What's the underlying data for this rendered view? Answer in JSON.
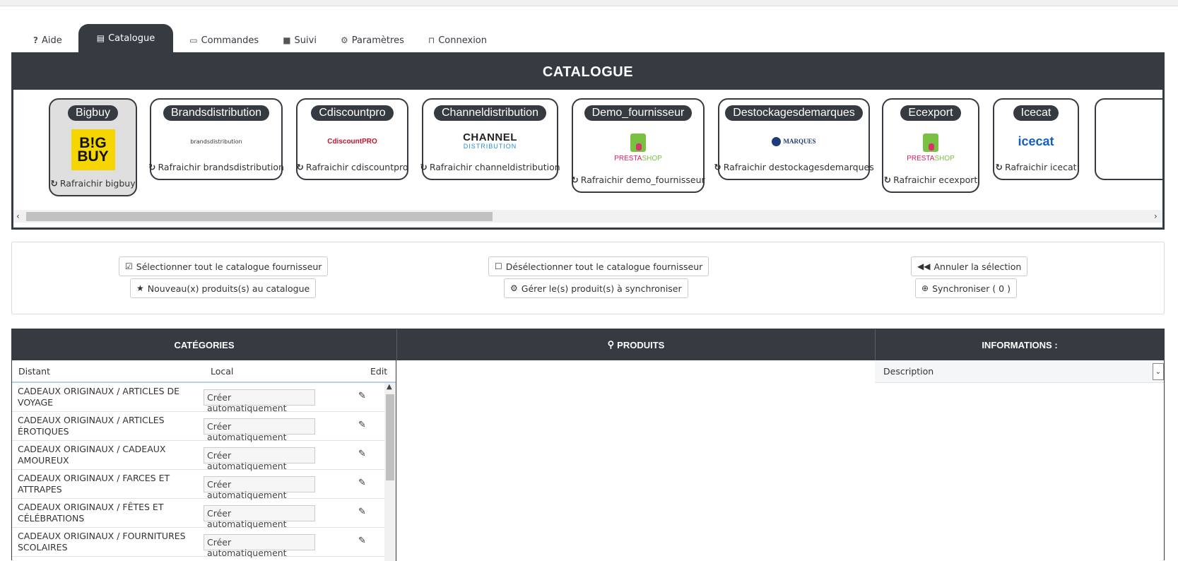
{
  "tabs": [
    {
      "icon": "?",
      "label": "Aide"
    },
    {
      "icon": "📘",
      "label": "Catalogue"
    },
    {
      "icon": "▭",
      "label": "Commandes"
    },
    {
      "icon": "🚚",
      "label": "Suivi"
    },
    {
      "icon": "⚙",
      "label": "Paramètres"
    },
    {
      "icon": "🔓",
      "label": "Connexion"
    }
  ],
  "catalog": {
    "title": "CATALOGUE",
    "refresh_icon": "↻",
    "suppliers": [
      {
        "name": "Bigbuy",
        "refresh": "Rafraichir bigbuy",
        "logo": "bigbuy",
        "logo_text": "B!G BUY"
      },
      {
        "name": "Brandsdistribution",
        "refresh": "Rafraichir brandsdistribution",
        "logo": "brandsdistribution",
        "logo_text": "brandsdistribution"
      },
      {
        "name": "Cdiscountpro",
        "refresh": "Rafraichir cdiscountpro",
        "logo": "cdiscountpro",
        "logo_text": "CdiscountPRO"
      },
      {
        "name": "Channeldistribution",
        "refresh": "Rafraichir channeldistribution",
        "logo": "channel",
        "logo_text": "CHANNEL",
        "logo_sub": "DISTRIBUTION"
      },
      {
        "name": "Demo_fournisseur",
        "refresh": "Rafraichir demo_fournisseur",
        "logo": "prestashop",
        "logo_text": "PRESTA",
        "logo_sub": "SHOP"
      },
      {
        "name": "Destockagesdemarques",
        "refresh": "Rafraichir destockagesdemarques",
        "logo": "destockages",
        "logo_text": "MARQUES"
      },
      {
        "name": "Ecexport",
        "refresh": "Rafraichir ecexport",
        "logo": "prestashop",
        "logo_text": "PRESTA",
        "logo_sub": "SHOP"
      },
      {
        "name": "Icecat",
        "refresh": "Rafraichir icecat",
        "logo": "icecat",
        "logo_text": "icecat"
      }
    ]
  },
  "actions": {
    "select_all": "Sélectionner tout le catalogue fournisseur",
    "new_products": "Nouveau(x) produits(s) au catalogue",
    "deselect_all": "Désélectionner tout le catalogue fournisseur",
    "manage_sync": "Gérer le(s) produit(s) à synchroniser",
    "cancel_selection": "Annuler la sélection",
    "synchronize": "Synchroniser ( 0 )"
  },
  "grid": {
    "categories_header": "CATÉGORIES",
    "products_header": "PRODUITS",
    "info_header": "INFORMATIONS :",
    "col_distant": "Distant",
    "col_local": "Local",
    "col_edit": "Edit",
    "local_value": "Créer automatiquement",
    "rows": [
      "CADEAUX ORIGINAUX / ARTICLES DE VOYAGE",
      "CADEAUX ORIGINAUX / ARTICLES ÉROTIQUES",
      "CADEAUX ORIGINAUX / CADEAUX AMOUREUX",
      "CADEAUX ORIGINAUX / FARCES ET ATTRAPES",
      "CADEAUX ORIGINAUX / FÊTES ET CÉLÉBRATIONS",
      "CADEAUX ORIGINAUX / FOURNITURES SCOLAIRES"
    ],
    "info_select": "Description"
  }
}
